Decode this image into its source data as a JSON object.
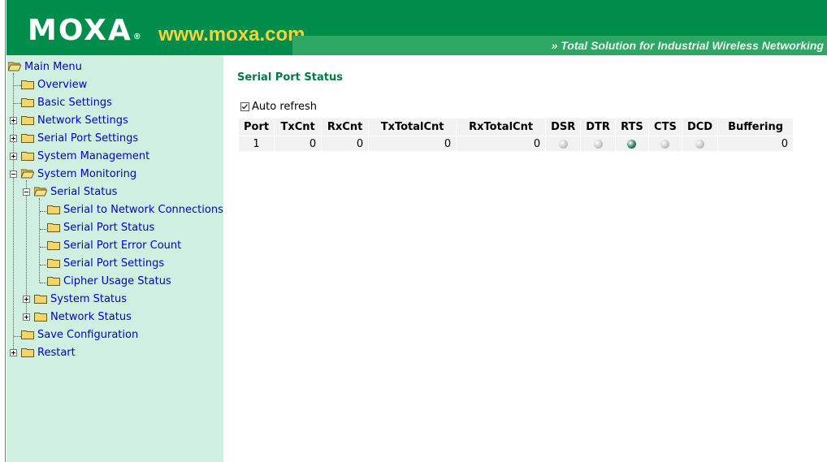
{
  "header": {
    "logo_text": "MOXA",
    "logo_reg": "®",
    "url": "www.moxa.com",
    "tagline": "» Total Solution for Industrial Wireless Networking"
  },
  "menu": {
    "root": "Main Menu",
    "items": [
      {
        "label": "Overview"
      },
      {
        "label": "Basic Settings"
      },
      {
        "label": "Network Settings"
      },
      {
        "label": "Serial Port Settings"
      },
      {
        "label": "System Management"
      },
      {
        "label": "System Monitoring"
      },
      {
        "label": "Serial Status"
      },
      {
        "label": "Serial to Network Connections"
      },
      {
        "label": "Serial Port Status"
      },
      {
        "label": "Serial Port Error Count"
      },
      {
        "label": "Serial Port Settings"
      },
      {
        "label": "Cipher Usage Status"
      },
      {
        "label": "System Status"
      },
      {
        "label": "Network Status"
      },
      {
        "label": "Save Configuration"
      },
      {
        "label": "Restart"
      }
    ]
  },
  "main": {
    "title": "Serial Port Status",
    "auto_refresh_label": "Auto refresh",
    "auto_refresh_checked": true,
    "table": {
      "headers": [
        "Port",
        "TxCnt",
        "RxCnt",
        "TxTotalCnt",
        "RxTotalCnt",
        "DSR",
        "DTR",
        "RTS",
        "CTS",
        "DCD",
        "Buffering"
      ],
      "rows": [
        {
          "port": "1",
          "txcnt": "0",
          "rxcnt": "0",
          "txtotalcnt": "0",
          "rxtotalcnt": "0",
          "dsr": "off",
          "dtr": "off",
          "rts": "on",
          "cts": "off",
          "dcd": "off",
          "buffering": "0"
        }
      ]
    }
  },
  "colors": {
    "header_green": "#008c4a",
    "sidebar_bg": "#cff0e0",
    "title_green": "#007a44",
    "link_blue": "#0000cc",
    "led_off": "#c8c8c8",
    "led_on": "#2e7d5a"
  }
}
